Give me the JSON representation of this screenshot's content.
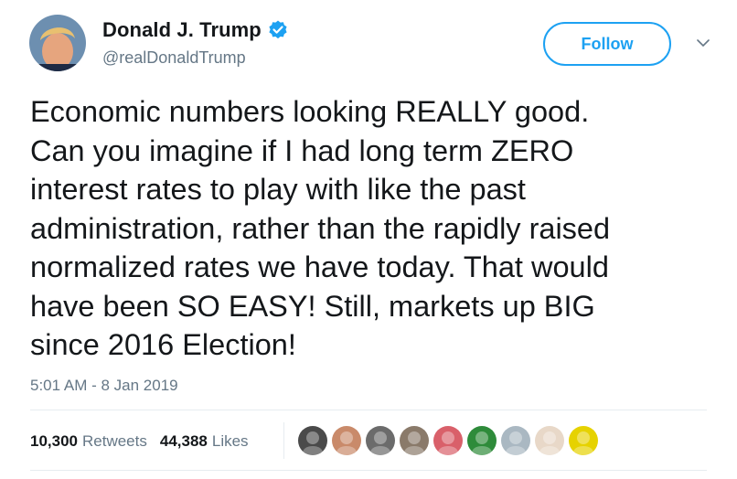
{
  "author": {
    "display_name": "Donald J. Trump",
    "handle": "@realDonaldTrump",
    "verified": true,
    "avatar_icon": "profile-photo"
  },
  "follow_button": {
    "label": "Follow"
  },
  "menu": {
    "icon": "chevron-down-icon"
  },
  "tweet": {
    "text": "Economic numbers looking REALLY good.\nCan you imagine if I had long term ZERO\ninterest rates to play with like the past\nadministration, rather than the rapidly raised\nnormalized rates we have today. That would\nhave been SO EASY! Still, markets up BIG\nsince 2016 Election!",
    "timestamp": "5:01 AM - 8 Jan 2019"
  },
  "stats": {
    "retweets_count": "10,300",
    "retweets_label": "Retweets",
    "likes_count": "44,388",
    "likes_label": "Likes"
  },
  "likers": [
    {
      "name": "liker-avatar-1",
      "color": "#4a4a4a"
    },
    {
      "name": "liker-avatar-2",
      "color": "#c98a6a"
    },
    {
      "name": "liker-avatar-3",
      "color": "#6b6b6b"
    },
    {
      "name": "liker-avatar-4",
      "color": "#8a7a6a"
    },
    {
      "name": "liker-avatar-5",
      "color": "#d9606a"
    },
    {
      "name": "liker-avatar-6",
      "color": "#2e8b3a"
    },
    {
      "name": "liker-avatar-7",
      "color": "#aab8c2"
    },
    {
      "name": "liker-avatar-8",
      "color": "#e8d8c8"
    },
    {
      "name": "liker-avatar-9",
      "color": "#e6d200"
    }
  ],
  "colors": {
    "accent": "#1da1f2",
    "text": "#14171a",
    "secondary": "#657786",
    "divider": "#e6ecf0"
  }
}
